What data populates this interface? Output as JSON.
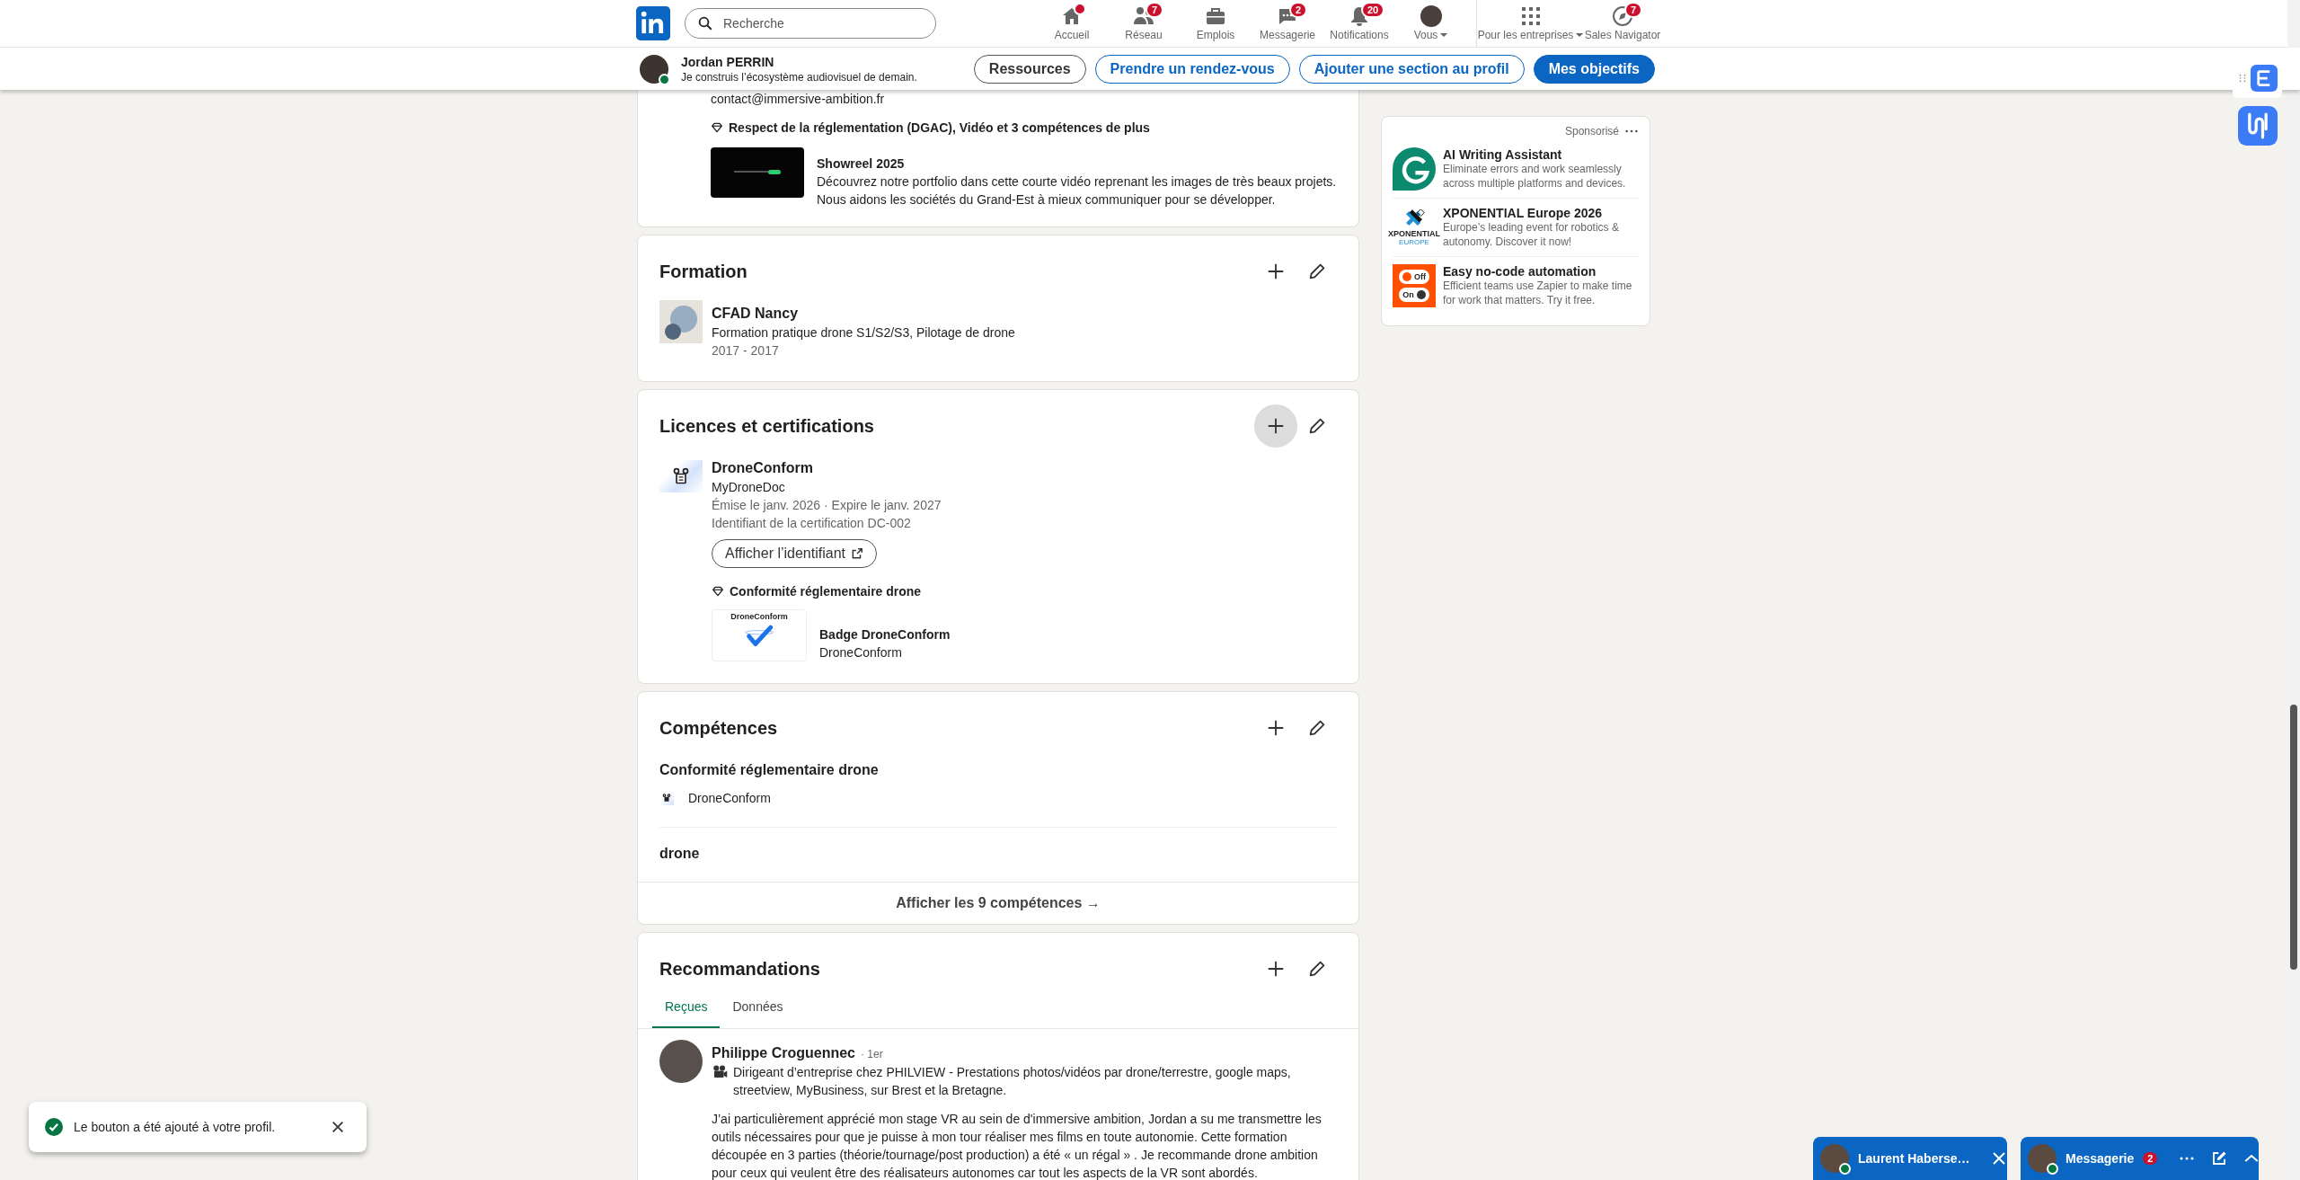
{
  "nav": {
    "search": {
      "placeholder": "Recherche"
    },
    "items": [
      {
        "label": "Accueil",
        "dot": true,
        "dropdown": false
      },
      {
        "label": "Réseau",
        "badge": "7",
        "dot": false,
        "dropdown": false
      },
      {
        "label": "Emplois",
        "dot": false,
        "dropdown": false
      },
      {
        "label": "Messagerie",
        "badge": "2",
        "dot": false,
        "dropdown": false
      },
      {
        "label": "Notifications",
        "badge": "20",
        "dot": false,
        "dropdown": false
      },
      {
        "label": "Vous",
        "dot": false,
        "dropdown": true
      },
      {
        "label": "Pour les entreprises",
        "dot": false,
        "dropdown": true
      },
      {
        "label": "Sales Navigator",
        "badge": "7",
        "dot": false,
        "dropdown": false
      }
    ]
  },
  "profile_bar": {
    "name": "Jordan PERRIN",
    "headline": "Je construis l’écosystème audiovisuel de demain.",
    "online": true,
    "buttons": [
      {
        "label": "Ressources",
        "kind": "secondary"
      },
      {
        "label": "Prendre un rendez-vous",
        "kind": "outline"
      },
      {
        "label": "Ajouter une section au profil",
        "kind": "outline"
      },
      {
        "label": "Mes objectifs",
        "kind": "primary"
      }
    ]
  },
  "sections": [
    {
      "kind": "experience_tail",
      "contact": "contact@immersive-ambition.fr",
      "skills": "Respect de la réglementation (DGAC), Vidéo et 3 compétences de plus",
      "media": {
        "title": "Showreel 2025",
        "description": "Découvrez notre portfolio dans cette courte vidéo reprenant les images de très beaux projets. Nous aidons les sociétés du Grand-Est à mieux communiquer pour se développer."
      }
    },
    {
      "kind": "education",
      "title": "Formation",
      "add_hovered": false,
      "entries": [
        {
          "school": "CFAD Nancy",
          "degree": "Formation pratique drone S1/S2/S3, Pilotage de drone",
          "dates": "2017 - 2017"
        }
      ]
    },
    {
      "kind": "certifications",
      "title": "Licences et certifications",
      "add_hovered": true,
      "entries": [
        {
          "name": "DroneConform",
          "issuer": "MyDroneDoc",
          "dates": "Émise le janv. 2026 · Expire le janv. 2027",
          "credential": "Identifiant de la certification DC-002",
          "button": "Afficher l’identifiant",
          "skill": "Conformité réglementaire drone",
          "media": {
            "thumbnail_label": "DroneConform",
            "title": "Badge DroneConform",
            "subtitle": "DroneConform"
          }
        }
      ]
    },
    {
      "kind": "skills",
      "title": "Compétences",
      "add_hovered": false,
      "skills": [
        {
          "name": "Conformité réglementaire drone",
          "source": "DroneConform"
        },
        {
          "name": "drone"
        }
      ],
      "footer": "Afficher les 9 compétences →"
    },
    {
      "kind": "recommendations",
      "title": "Recommandations",
      "add_hovered": false,
      "tabs": [
        {
          "label": "Reçues",
          "selected": true
        },
        {
          "label": "Données",
          "selected": false
        }
      ],
      "items": [
        {
          "name": "Philippe Croguennec",
          "degree": "· 1er",
          "headline": "Dirigeant d’entreprise chez PHILVIEW - Prestations photos/vidéos par drone/terrestre, google maps, streetview, MyBusiness, sur Brest et la Bretagne.",
          "text": "J’ai particulièrement apprécié mon stage VR au sein de d'immersive ambition, Jordan a su me transmettre les outils nécessaires pour que je puisse à mon tour réaliser mes films en toute autonomie. Cette formation découpée en 3 parties (théorie/tournage/post production) a été « un régal » . Je recommande drone ambition pour ceux qui veulent être des réalisateurs autonomes car tout les aspects de la VR sont abordés."
        }
      ]
    }
  ],
  "ads": {
    "label": "Sponsorisé",
    "items": [
      {
        "title": "AI Writing Assistant",
        "text": "Eliminate errors and work seamlessly across multiple platforms and devices."
      },
      {
        "title": "XPONENTIAL Europe 2026",
        "text": "Europe’s leading event for robotics & autonomy. Discover it now!",
        "logo_text": "XPONENTIAL",
        "logo_subtext": "EUROPE"
      },
      {
        "title": "Easy no-code automation",
        "text": "Efficient teams use Zapier to make time for work that matters. Try it free.",
        "logo_toggles": [
          {
            "label": "Off",
            "on": false
          },
          {
            "label": "On",
            "on": true
          }
        ]
      }
    ]
  },
  "toast": {
    "text": "Le bouton a été ajouté à votre profil."
  },
  "chats": [
    {
      "kind": "conversation",
      "name": "Laurent Haberse…",
      "online": true
    },
    {
      "kind": "inbox",
      "name": "Messagerie",
      "badge": "2",
      "online": true
    }
  ]
}
